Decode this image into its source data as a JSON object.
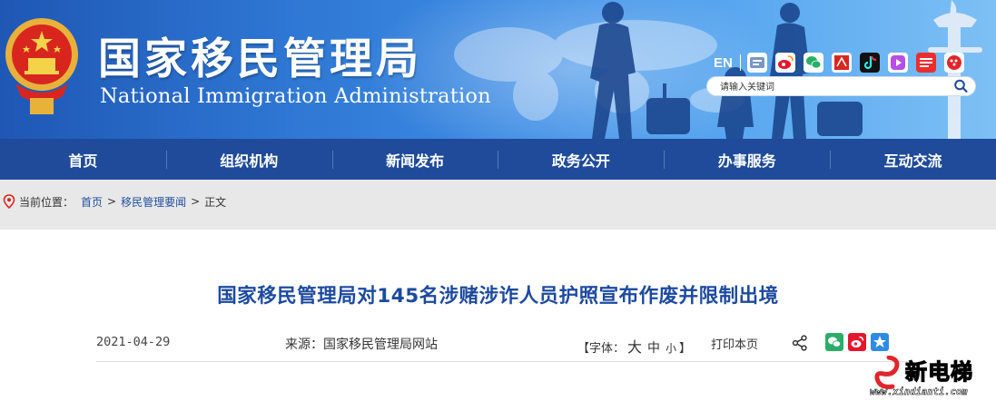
{
  "header": {
    "title": "国家移民管理局",
    "subtitle": "National Immigration Administration",
    "lang_link": "EN",
    "toolbar_icons": [
      "app-icon",
      "weibo-icon",
      "wechat-icon",
      "people-daily-icon",
      "douyin-icon",
      "kuaishou-icon",
      "toutiao-icon",
      "cctv-icon"
    ],
    "search_placeholder": "请输入关键词"
  },
  "nav": {
    "items": [
      "首页",
      "组织机构",
      "新闻发布",
      "政务公开",
      "办事服务",
      "互动交流"
    ]
  },
  "breadcrumb": {
    "label": "当前位置：",
    "home": "首页",
    "sep1": ">",
    "section": "移民管理要闻",
    "sep2": ">",
    "current": "正文"
  },
  "article": {
    "title": "国家移民管理局对145名涉赌涉诈人员护照宣布作废并限制出境",
    "date": "2021-04-29",
    "source": "来源：国家移民管理局网站",
    "font_label_open": "【字体：",
    "font_large": "大",
    "font_mid": "中",
    "font_small": "小",
    "font_label_close": "】",
    "print": "打印本页"
  },
  "watermark": {
    "brand": "新电梯",
    "url": "www.xindianti.com"
  },
  "colors": {
    "header_blue": "#2f78d4",
    "nav_blue": "#1f4b9a",
    "title_blue": "#1d4aa0",
    "link_blue": "#1f4fa0"
  }
}
